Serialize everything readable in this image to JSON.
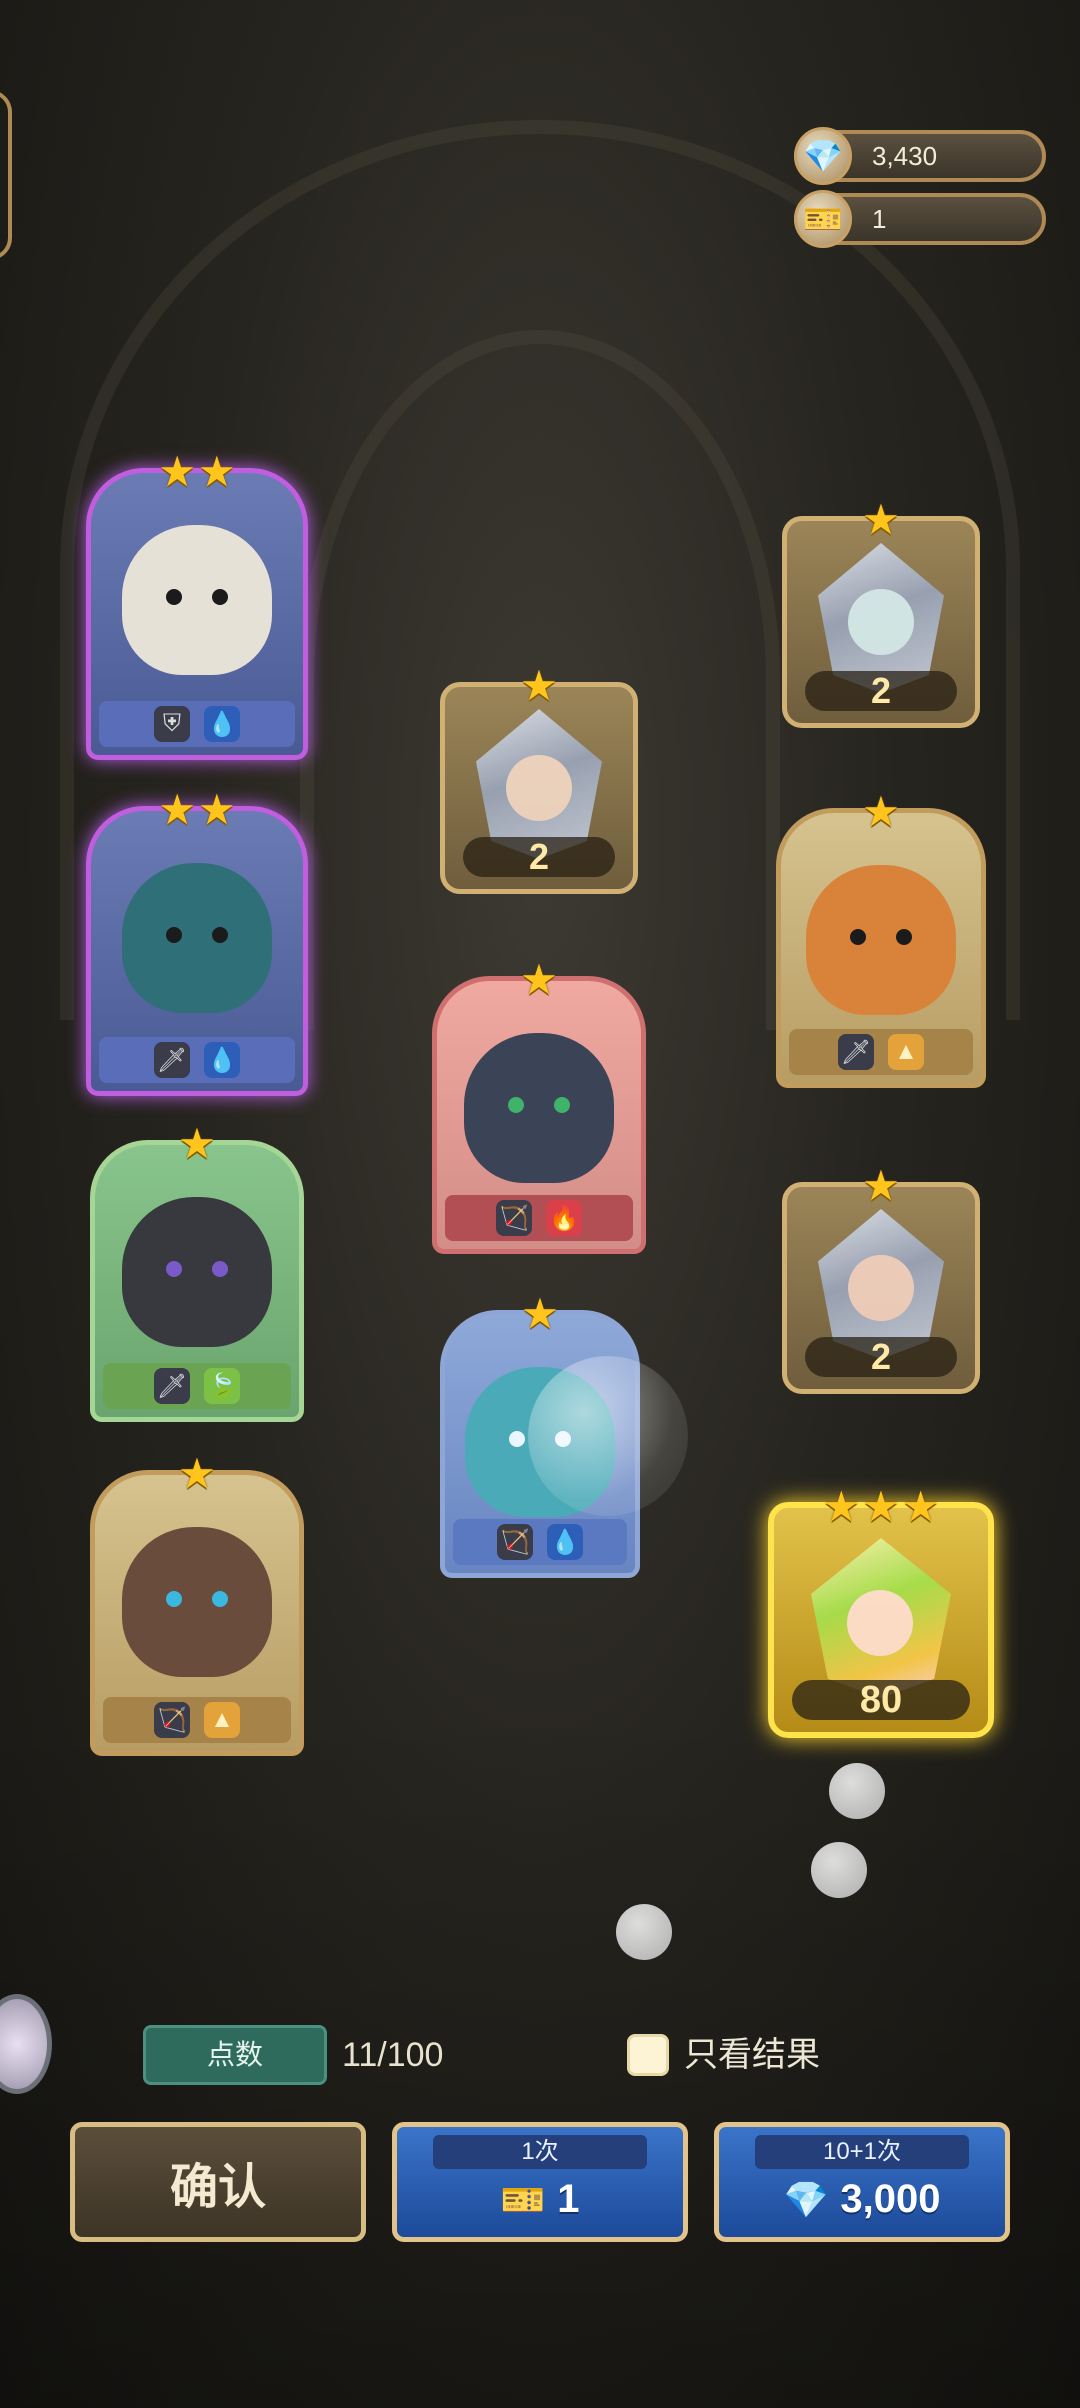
{
  "resources": {
    "gems": {
      "icon": "gem-icon",
      "value": "3,430"
    },
    "tickets": {
      "icon": "ticket-icon",
      "value": "1"
    }
  },
  "heroes": [
    {
      "stars": 2,
      "rarity": "purple",
      "elements": [
        "shield-icon",
        "water-icon"
      ]
    },
    {
      "stars": 2,
      "rarity": "purple",
      "elements": [
        "sword-icon",
        "water-icon"
      ]
    },
    {
      "stars": 1,
      "rarity": "green",
      "elements": [
        "sword-icon",
        "leaf-icon"
      ]
    },
    {
      "stars": 1,
      "rarity": "gold",
      "elements": [
        "bow-icon",
        "earth-icon"
      ]
    },
    {
      "stars": 1,
      "rarity": "red",
      "elements": [
        "bow-icon",
        "fire-icon"
      ]
    },
    {
      "stars": 1,
      "rarity": "blue",
      "elements": [
        "bow-icon",
        "water-icon"
      ]
    },
    {
      "stars": 1,
      "rarity": "gold",
      "elements": [
        "sword-icon",
        "earth-icon"
      ]
    }
  ],
  "crystals": [
    {
      "stars": 1,
      "count": "2"
    },
    {
      "stars": 1,
      "count": "2"
    },
    {
      "stars": 1,
      "count": "2"
    },
    {
      "stars": 3,
      "count": "80"
    }
  ],
  "points": {
    "label": "点数",
    "value": "11/100"
  },
  "result_only": {
    "label": "只看结果",
    "checked": false
  },
  "buttons": {
    "confirm": "确认",
    "single": {
      "label": "1次",
      "icon": "ticket-icon",
      "cost": "1"
    },
    "multi": {
      "label": "10+1次",
      "icon": "gem-icon",
      "cost": "3,000"
    }
  }
}
